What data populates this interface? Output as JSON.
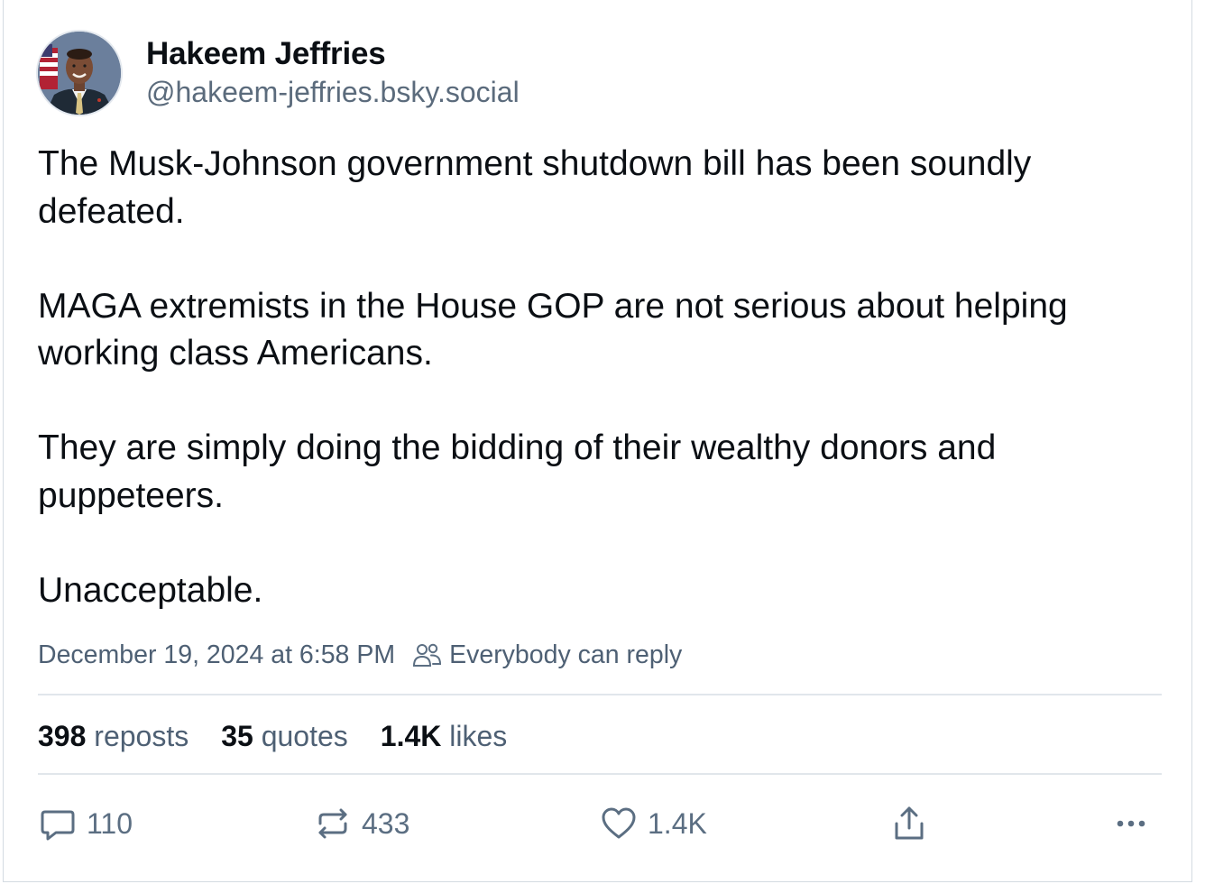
{
  "author": {
    "display_name": "Hakeem Jeffries",
    "handle": "@hakeem-jeffries.bsky.social"
  },
  "post": {
    "paragraphs": [
      "The Musk-Johnson government shutdown bill has been soundly defeated.",
      "MAGA extremists in the House GOP are not serious about helping working class Americans.",
      "They are simply doing the bidding of their wealthy donors and puppeteers.",
      "Unacceptable."
    ],
    "timestamp": "December 19, 2024 at 6:58 PM",
    "reply_setting": "Everybody can reply"
  },
  "stats": {
    "reposts_count": "398",
    "reposts_label": "reposts",
    "quotes_count": "35",
    "quotes_label": "quotes",
    "likes_count": "1.4K",
    "likes_label": "likes"
  },
  "actions": {
    "reply_count": "110",
    "repost_count": "433",
    "like_count": "1.4K"
  },
  "colors": {
    "text_primary": "#0b0f14",
    "text_secondary": "#4e6074",
    "divider": "#e1e6eb",
    "icon": "#5b6e82"
  },
  "icons": [
    "avatar-photo",
    "people-icon",
    "reply-icon",
    "repost-icon",
    "heart-icon",
    "share-icon",
    "more-icon"
  ]
}
